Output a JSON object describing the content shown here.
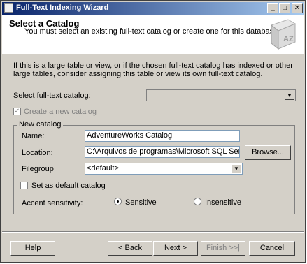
{
  "window": {
    "title": "Full-Text Indexing Wizard",
    "controls": {
      "minimize": "_",
      "maximize": "□",
      "close": "✕"
    }
  },
  "header": {
    "title": "Select a Catalog",
    "subtitle": "You must select an existing full-text catalog or create one for this database.",
    "logo_icon": "az-book-icon",
    "logo_text": "AZ"
  },
  "content": {
    "info_text": "If this is a large table or view, or if the chosen full-text catalog has indexed or other large tables, consider assigning this table or view its own full-text catalog.",
    "select_catalog_label": "Select full-text catalog:",
    "select_catalog_value": "",
    "create_new_label": "Create a new catalog",
    "create_new_checked": true,
    "create_new_enabled": false,
    "group_label": "New catalog",
    "name_label": "Name:",
    "name_value": "AdventureWorks Catalog",
    "location_label": "Location:",
    "location_value": "C:\\Arquivos de programas\\Microsoft SQL Server\\MS",
    "browse_label": "Browse...",
    "filegroup_label": "Filegroup",
    "filegroup_value": "<default>",
    "default_catalog_label": "Set as default catalog",
    "default_catalog_checked": false,
    "accent_label": "Accent sensitivity:",
    "sensitive_label": "Sensitive",
    "insensitive_label": "Insensitive",
    "accent_selected": "Sensitive"
  },
  "footer": {
    "help": "Help",
    "back": "< Back",
    "next": "Next >",
    "finish": "Finish >>|",
    "cancel": "Cancel"
  }
}
